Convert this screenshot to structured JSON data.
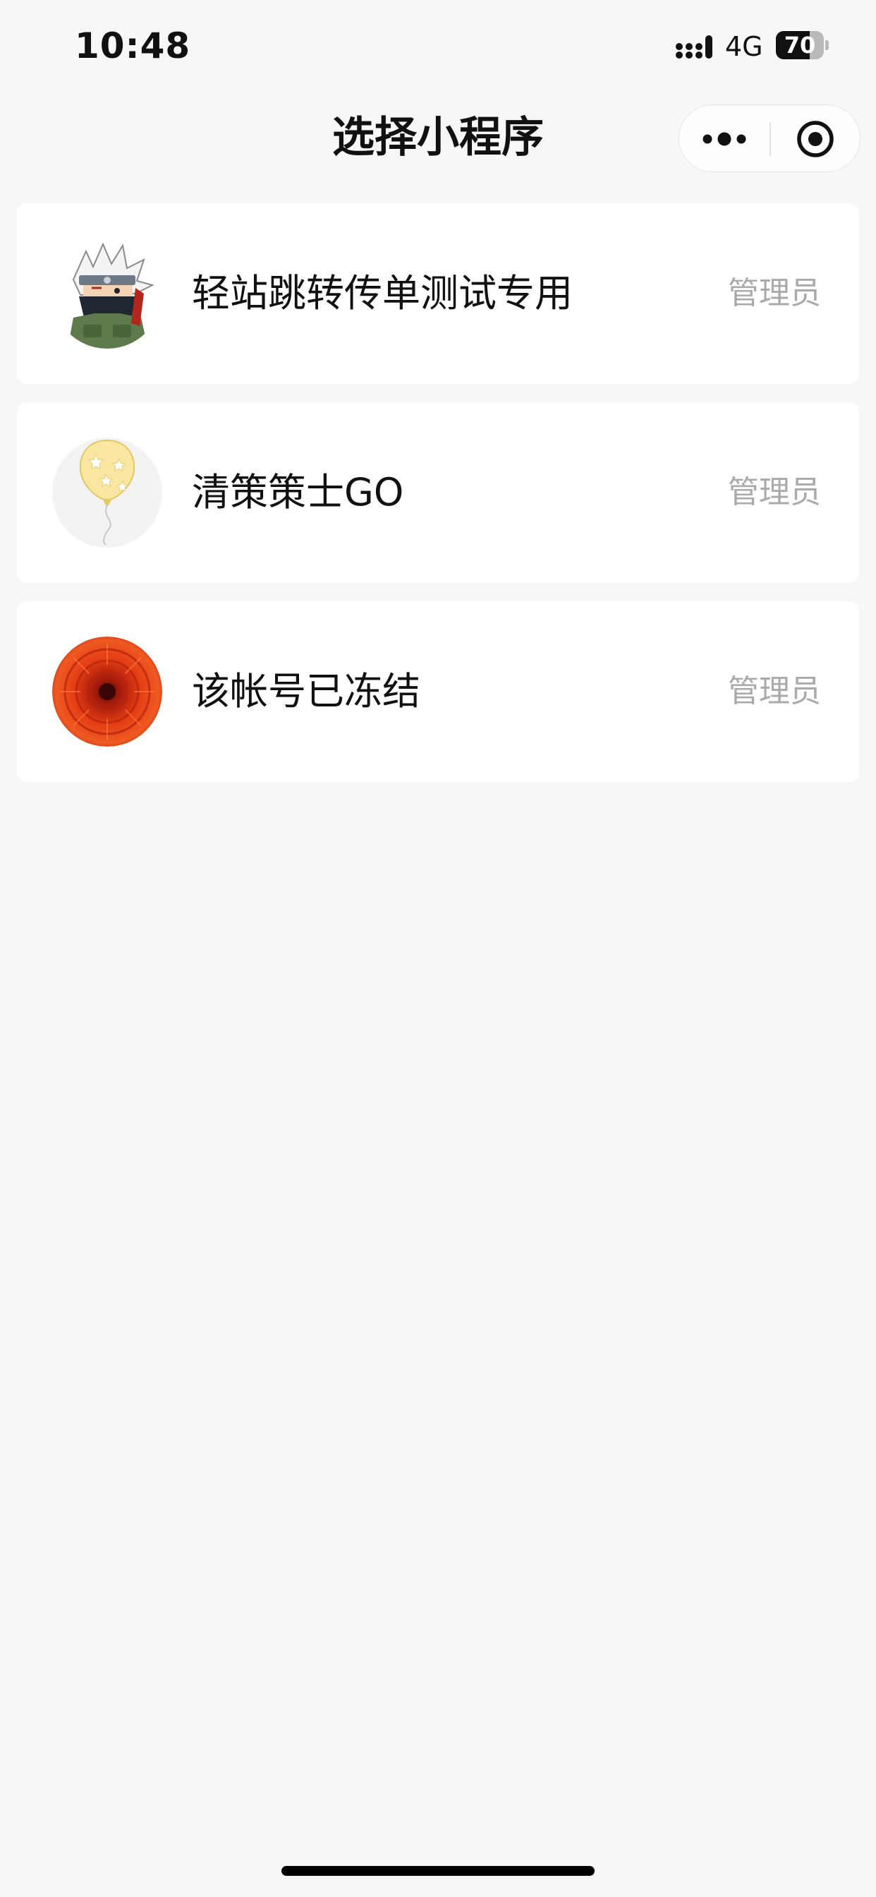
{
  "status_bar": {
    "time": "10:48",
    "network": "4G",
    "battery": "70",
    "battery_level": 0.7
  },
  "nav": {
    "title": "选择小程序",
    "more_icon": "more-dots-icon",
    "close_icon": "target-close-icon"
  },
  "apps": [
    {
      "name": "轻站跳转传单测试专用",
      "role": "管理员",
      "avatar_icon": "ninja-avatar"
    },
    {
      "name": "清策策士GO",
      "role": "管理员",
      "avatar_icon": "star-balloon-avatar"
    },
    {
      "name": "该帐号已冻结",
      "role": "管理员",
      "avatar_icon": "red-flower-avatar"
    }
  ],
  "colors": {
    "background": "#f7f7f7",
    "card": "#ffffff",
    "role_text": "#aaaaaa"
  }
}
